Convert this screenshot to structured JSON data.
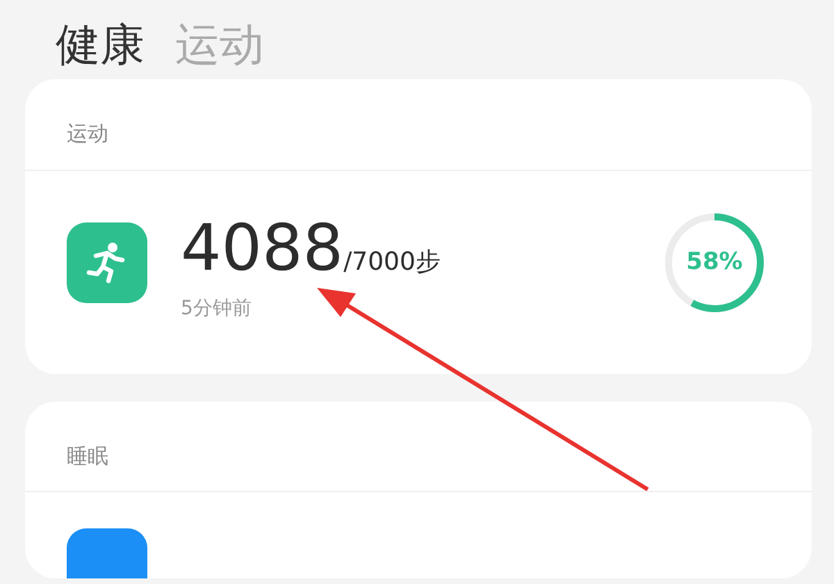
{
  "tabs": [
    {
      "label": "健康",
      "selected": true
    },
    {
      "label": "运动",
      "selected": false
    }
  ],
  "cards": [
    {
      "title": "运动",
      "value": "4088",
      "goal": "/7000步",
      "time": "5分钟前",
      "ring": {
        "level": 0.58,
        "label": "58%"
      }
    },
    {
      "title": "睡眠"
    }
  ]
}
